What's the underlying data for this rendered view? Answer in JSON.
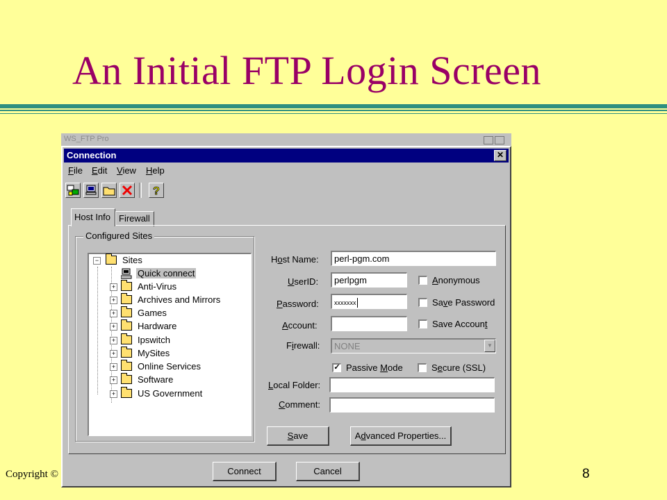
{
  "slide": {
    "title": "An Initial FTP Login Screen",
    "copyright": "Copyright ©",
    "page_number": "8",
    "title_color": "#990066",
    "background_color": "#ffff99",
    "rule_color": "#2f8f80"
  },
  "window": {
    "background_title": "WS_FTP Pro",
    "title": "Connection",
    "close_label": "✕",
    "titlebar_color": "#000080"
  },
  "menu": {
    "file": {
      "underlined": "F",
      "rest": "ile"
    },
    "edit": {
      "underlined": "E",
      "rest": "dit"
    },
    "view": {
      "underlined": "V",
      "rest": "iew"
    },
    "help": {
      "underlined": "H",
      "rest": "elp"
    }
  },
  "toolbar": {
    "icons": [
      "new-site-icon",
      "connect-icon",
      "new-folder-icon",
      "delete-icon",
      "help-icon"
    ]
  },
  "tabs": {
    "host_info": "Host Info",
    "firewall": "Firewall"
  },
  "sites": {
    "group_label": "Configured Sites",
    "root": "Sites",
    "items": [
      {
        "label": "Quick connect",
        "icon": "computer-icon",
        "selected": true
      },
      {
        "label": "Anti-Virus",
        "icon": "folder-icon"
      },
      {
        "label": "Archives and Mirrors",
        "icon": "folder-icon"
      },
      {
        "label": "Games",
        "icon": "folder-icon"
      },
      {
        "label": "Hardware",
        "icon": "folder-icon"
      },
      {
        "label": "Ipswitch",
        "icon": "folder-icon"
      },
      {
        "label": "MySites",
        "icon": "folder-icon"
      },
      {
        "label": "Online Services",
        "icon": "folder-icon"
      },
      {
        "label": "Software",
        "icon": "folder-icon"
      },
      {
        "label": "US Government",
        "icon": "folder-icon"
      }
    ]
  },
  "form": {
    "host_name": {
      "label_pre": "H",
      "label_u": "o",
      "label_post": "st Name:",
      "value": "perl-pgm.com"
    },
    "user_id": {
      "label_pre": "",
      "label_u": "U",
      "label_post": "serID:",
      "value": "perlpgm"
    },
    "password": {
      "label_pre": "",
      "label_u": "P",
      "label_post": "assword:",
      "value": "xxxxxxx"
    },
    "account": {
      "label_pre": "",
      "label_u": "A",
      "label_post": "ccount:",
      "value": ""
    },
    "firewall": {
      "label_pre": "F",
      "label_u": "i",
      "label_post": "rewall:",
      "value": "NONE"
    },
    "local_folder": {
      "label_pre": "",
      "label_u": "L",
      "label_post": "ocal Folder:",
      "value": ""
    },
    "comment": {
      "label_pre": "",
      "label_u": "C",
      "label_post": "omment:",
      "value": ""
    },
    "anonymous": {
      "label_pre": "",
      "label_u": "A",
      "label_post": "nonymous",
      "checked": false
    },
    "save_password": {
      "label_pre": "Sa",
      "label_u": "v",
      "label_post": "e Password",
      "checked": false
    },
    "save_account": {
      "label_pre": "Save Accoun",
      "label_u": "t",
      "label_post": "",
      "checked": false
    },
    "passive_mode": {
      "label_pre": "Passive ",
      "label_u": "M",
      "label_post": "ode",
      "checked": true,
      "check_mark": "✓"
    },
    "secure_ssl": {
      "label_pre": "S",
      "label_u": "e",
      "label_post": "cure (SSL)",
      "checked": false
    }
  },
  "buttons": {
    "save": {
      "label_pre": "",
      "label_u": "S",
      "label_post": "ave"
    },
    "advanced": {
      "label_pre": "A",
      "label_u": "d",
      "label_post": "vanced Properties..."
    },
    "connect": "Connect",
    "cancel": "Cancel"
  }
}
